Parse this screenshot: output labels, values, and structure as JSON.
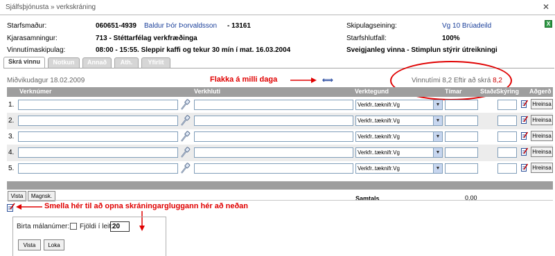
{
  "titlebar": {
    "breadcrumb": "Sjálfsþjónusta » verkskráning",
    "close": "✕"
  },
  "info": {
    "starfsmadur_label": "Starfsmaður:",
    "starfsmadur_id": "060651-4939",
    "starfsmadur_name": "Baldur Þór Þorvaldsson",
    "starfsmadur_num": "- 13161",
    "kjara_label": "Kjarasamningur:",
    "kjara_value": "713 - Stéttarfélag verkfræðinga",
    "vinnutima_label": "Vinnutímaskipulag:",
    "vinnutima_value": "08:00 - 15:55. Sleppir kaffi og tekur 30 mín í mat. 16.03.2004",
    "skipulag_label": "Skipulagseining:",
    "skipulag_value": "Vg 10 Brúadeild",
    "hlutfall_label": "Starfshlutfall:",
    "hlutfall_value": "100%",
    "sveigjanleg": "Sveigjanleg vinna - Stimplun stýrir útreikningi",
    "excel_icon": "X"
  },
  "tabs": [
    "Skrá vinnu",
    "Notkun",
    "Annað",
    "Ath.",
    "Yfirlit"
  ],
  "date_line": "Miðvikudagur 18.02.2009",
  "nav_arrows": "⇐⇒",
  "vinnutimi_text": "Vinnutími 8,2 Eftir að skrá ",
  "vinnutimi_remaining": "8,2",
  "annotations": {
    "flakka": "Flakka á milli daga",
    "smella": "Smella hér til að opna skráningargluggann hér að neðan"
  },
  "table": {
    "headers": [
      "Verknúmer",
      "Verkhluti",
      "Verktegund",
      "Tímar",
      "Staða",
      "Skýring",
      "Aðgerð"
    ],
    "rows": [
      {
        "num": "1.",
        "verktegund": "Verkfr..tæknifr.Vg",
        "action": "Hreinsa"
      },
      {
        "num": "2.",
        "verktegund": "Verkfr..tæknifr.Vg",
        "action": "Hreinsa"
      },
      {
        "num": "3.",
        "verktegund": "Verkfr..tæknifr.Vg",
        "action": "Hreinsa"
      },
      {
        "num": "4.",
        "verktegund": "Verkfr..tæknifr.Vg",
        "action": "Hreinsa"
      },
      {
        "num": "5.",
        "verktegund": "Verkfr..tæknifr.Vg",
        "action": "Hreinsa"
      }
    ]
  },
  "buttons": {
    "vista": "Vista",
    "magnsk": "Magnsk."
  },
  "samtals_label": "Samtals",
  "samtals_value": "0,00",
  "panel": {
    "birta_label": "Birta málanúmer:",
    "fjoldi_label": "Fjöldi í leit:",
    "fjoldi_value": "20",
    "vista": "Vista",
    "loka": "Loka"
  },
  "colors": {
    "annotation": "#e00000",
    "link": "#1a3f9a",
    "header": "#9e9e9e"
  }
}
